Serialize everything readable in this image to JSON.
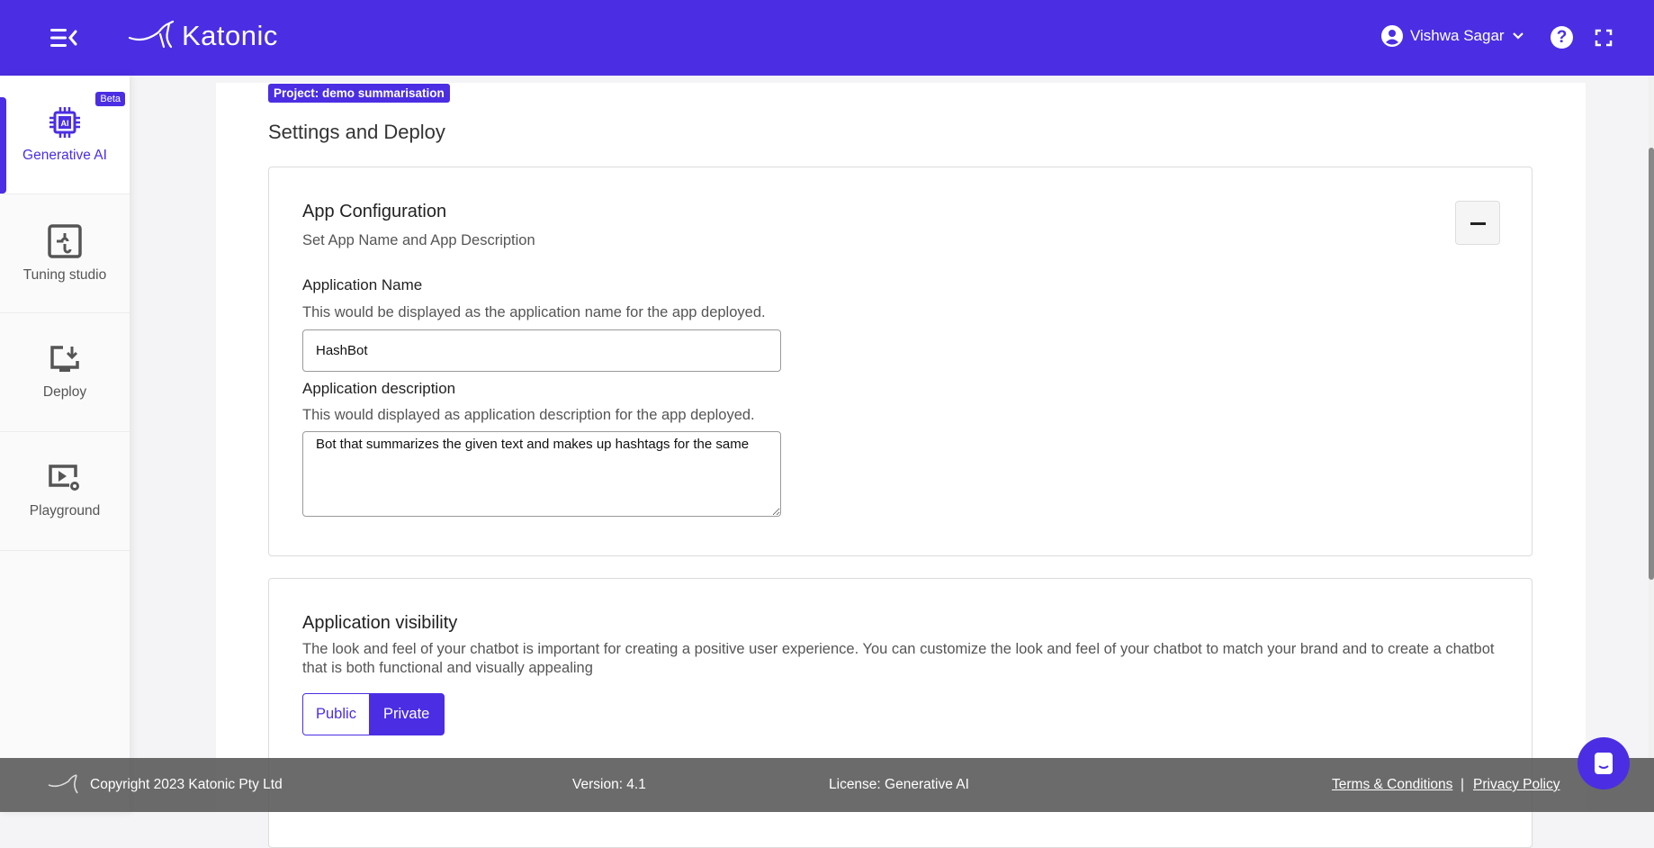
{
  "header": {
    "brand": "Katonic",
    "user_name": "Vishwa Sagar",
    "help_label": "?",
    "accent": "#4b2ee3"
  },
  "sidebar": {
    "items": [
      {
        "label": "Generative AI",
        "badge": "Beta",
        "icon": "ai-chip-icon",
        "active": true
      },
      {
        "label": "Tuning studio",
        "icon": "puzzle-icon"
      },
      {
        "label": "Deploy",
        "icon": "monitor-download-icon"
      },
      {
        "label": "Playground",
        "icon": "play-settings-icon"
      }
    ]
  },
  "main": {
    "project_badge": "Project: demo summarisation",
    "title": "Settings and Deploy",
    "app_config": {
      "title": "App Configuration",
      "subtitle": "Set App Name and App Description",
      "name_label": "Application Name",
      "name_help": "This would be displayed as the application name for the app deployed.",
      "name_value": "HashBot",
      "desc_label": "Application description",
      "desc_help": "This would displayed as application description for the app deployed.",
      "desc_value": "Bot that summarizes the given text and makes up hashtags for the same"
    },
    "visibility": {
      "title": "Application visibility",
      "description": "The look and feel of your chatbot is important for creating a positive user experience. You can customize the look and feel of your chatbot to match your brand and to create a chatbot that is both functional and visually appealing",
      "options": [
        "Public",
        "Private"
      ],
      "selected": "Private"
    }
  },
  "footer": {
    "copyright": "Copyright 2023 Katonic Pty Ltd",
    "version": "Version: 4.1",
    "license": "License: Generative AI",
    "terms": "Terms & Conditions",
    "separator": "|",
    "privacy": "Privacy Policy"
  }
}
